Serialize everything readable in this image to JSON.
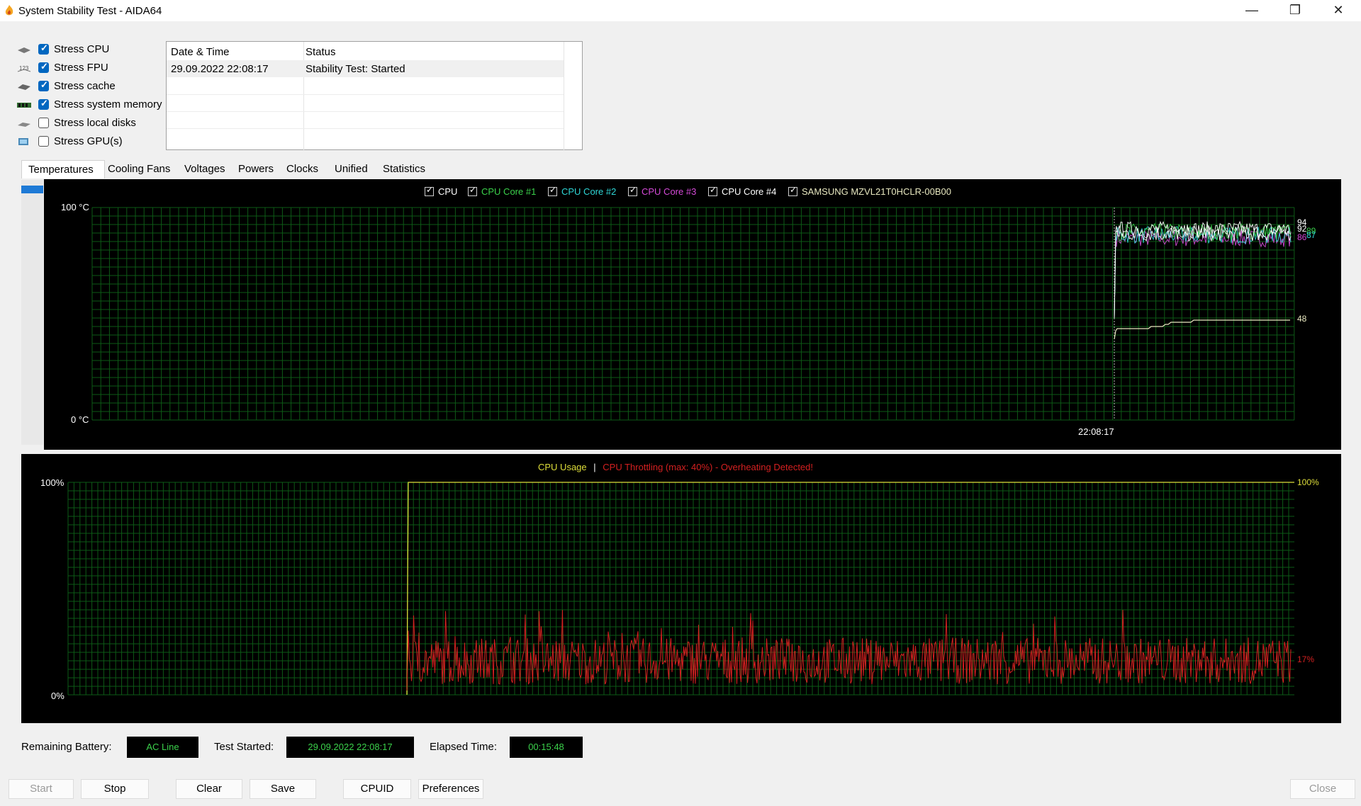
{
  "window": {
    "title": "System Stability Test - AIDA64",
    "minimize_glyph": "—",
    "restore_glyph": "❐",
    "close_glyph": "✕"
  },
  "stress_options": [
    {
      "label": "Stress CPU",
      "checked": true,
      "icon": "cpu-icon"
    },
    {
      "label": "Stress FPU",
      "checked": true,
      "icon": "fpu-icon"
    },
    {
      "label": "Stress cache",
      "checked": true,
      "icon": "cache-icon"
    },
    {
      "label": "Stress system memory",
      "checked": true,
      "icon": "memory-icon"
    },
    {
      "label": "Stress local disks",
      "checked": false,
      "icon": "disk-icon"
    },
    {
      "label": "Stress GPU(s)",
      "checked": false,
      "icon": "gpu-icon"
    }
  ],
  "log": {
    "headers": [
      "Date & Time",
      "Status"
    ],
    "rows": [
      {
        "datetime": "29.09.2022 22:08:17",
        "status": "Stability Test: Started"
      }
    ]
  },
  "tabs": [
    "Temperatures",
    "Cooling Fans",
    "Voltages",
    "Powers",
    "Clocks",
    "Unified",
    "Statistics"
  ],
  "active_tab": "Temperatures",
  "colors": {
    "grid": "#0d5a16",
    "cpu": "#ffffff",
    "core1": "#3bd14b",
    "core2": "#2fd6d6",
    "core3": "#d54ad8",
    "core4": "#ffffff",
    "ssd": "#e8e8c0",
    "usage": "#dede3a",
    "throttle": "#d42020"
  },
  "temp_chart": {
    "legend": [
      {
        "label": "CPU",
        "color": "#ffffff"
      },
      {
        "label": "CPU Core #1",
        "color": "#3bd14b"
      },
      {
        "label": "CPU Core #2",
        "color": "#2fd6d6"
      },
      {
        "label": "CPU Core #3",
        "color": "#d54ad8"
      },
      {
        "label": "CPU Core #4",
        "color": "#ffffff"
      },
      {
        "label": "SAMSUNG MZVL21T0HCLR-00B00",
        "color": "#e8e8c0"
      }
    ],
    "y_max_label": "100 °C",
    "y_min_label": "0 °C",
    "time_label": "22:08:17",
    "end_values": [
      "94",
      "92",
      "89",
      "87",
      "86",
      "48"
    ]
  },
  "usage_chart": {
    "title_usage": "CPU Usage",
    "separator": "|",
    "title_throttle": "CPU Throttling (max: 40%) - Overheating Detected!",
    "y_max_label": "100%",
    "y_min_label": "0%",
    "right_max_label": "100%",
    "right_throttle_label": "17%"
  },
  "chart_data": [
    {
      "type": "line",
      "title": "",
      "xlabel": "",
      "ylabel": "",
      "ylim": [
        0,
        100
      ],
      "x_marker": "22:08:17",
      "series": [
        {
          "name": "CPU",
          "last_value": 92
        },
        {
          "name": "CPU Core #1",
          "last_value": 89
        },
        {
          "name": "CPU Core #2",
          "last_value": 87
        },
        {
          "name": "CPU Core #3",
          "last_value": 86
        },
        {
          "name": "CPU Core #4",
          "last_value": 94
        },
        {
          "name": "SAMSUNG MZVL21T0HCLR-00B00",
          "last_value": 48
        }
      ]
    },
    {
      "type": "line",
      "title": "CPU Usage | CPU Throttling (max: 40%) - Overheating Detected!",
      "ylim": [
        0,
        100
      ],
      "series": [
        {
          "name": "CPU Usage",
          "last_value": 100
        },
        {
          "name": "CPU Throttling",
          "last_value": 17,
          "max": 40
        }
      ]
    }
  ],
  "status": {
    "battery_label": "Remaining Battery:",
    "battery_value": "AC Line",
    "started_label": "Test Started:",
    "started_value": "29.09.2022 22:08:17",
    "elapsed_label": "Elapsed Time:",
    "elapsed_value": "00:15:48"
  },
  "buttons": {
    "start": "Start",
    "stop": "Stop",
    "clear": "Clear",
    "save": "Save",
    "cpuid": "CPUID",
    "preferences": "Preferences",
    "close": "Close"
  }
}
